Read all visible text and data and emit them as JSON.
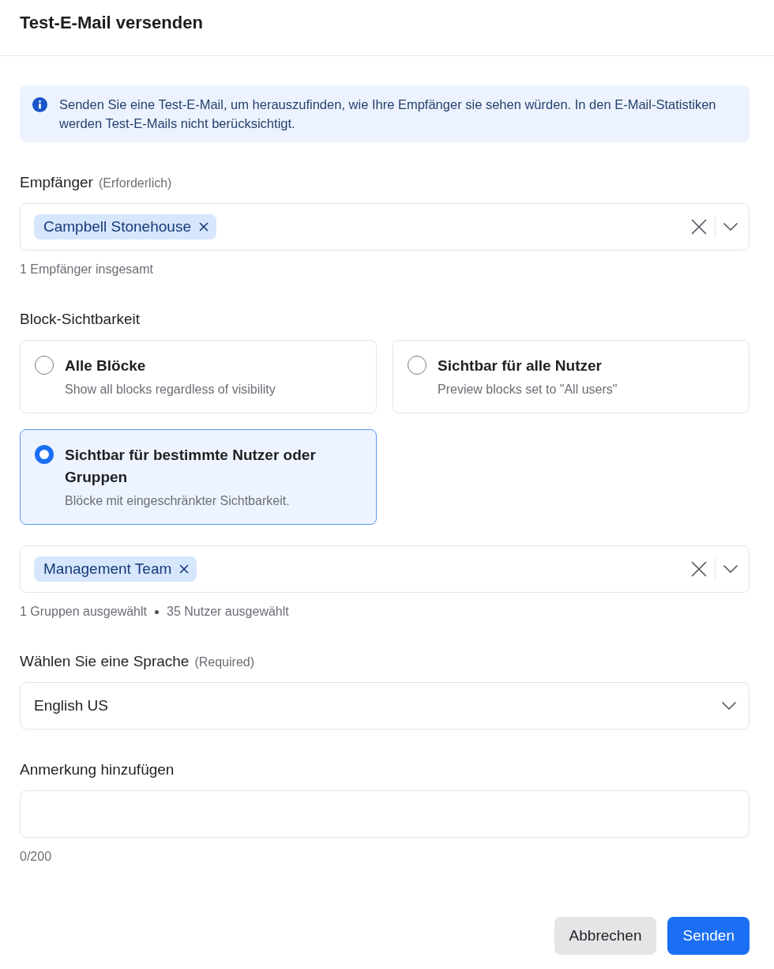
{
  "dialog": {
    "title": "Test-E-Mail versenden"
  },
  "info_banner": {
    "text": "Senden Sie eine Test-E-Mail, um herauszufinden, wie Ihre Empfänger sie sehen würden. In den E-Mail-Statistiken werden Test-E-Mails nicht berücksichtigt."
  },
  "recipients": {
    "label": "Empfänger",
    "hint": "(Erforderlich)",
    "chips": [
      {
        "label": "Campbell Stonehouse"
      }
    ],
    "summary": "1 Empfänger insgesamt"
  },
  "visibility": {
    "label": "Block-Sichtbarkeit",
    "options": [
      {
        "title": "Alle Blöcke",
        "description": "Show all blocks regardless of visibility",
        "selected": false
      },
      {
        "title": "Sichtbar für alle Nutzer",
        "description": "Preview blocks set to \"All users\"",
        "selected": false
      },
      {
        "title": "Sichtbar für bestimmte Nutzer oder Gruppen",
        "description": "Blöcke mit eingeschränkter Sichtbarkeit.",
        "selected": true
      }
    ]
  },
  "groups": {
    "chips": [
      {
        "label": "Management Team"
      }
    ],
    "summary": [
      "1 Gruppen ausgewählt",
      "35 Nutzer ausgewählt"
    ]
  },
  "language": {
    "label": "Wählen Sie eine Sprache",
    "hint": "(Required)",
    "value": "English US"
  },
  "note": {
    "label": "Anmerkung hinzufügen",
    "counter": "0/200"
  },
  "buttons": [
    {
      "label": "Abbrechen",
      "kind": "secondary"
    },
    {
      "label": "Senden",
      "kind": "primary"
    }
  ]
}
